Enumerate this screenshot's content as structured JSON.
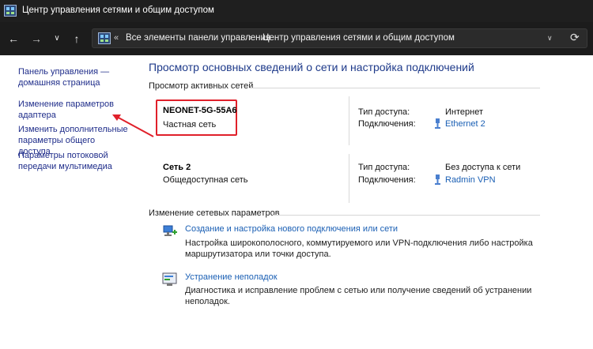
{
  "window": {
    "title": "Центр управления сетями и общим доступом"
  },
  "address_bar": {
    "crumbs": [
      "Все элементы панели управления",
      "Центр управления сетями и общим доступом"
    ]
  },
  "left_pane": {
    "links": [
      "Панель управления — домашняя страница",
      "Изменение параметров адаптера",
      "Изменить дополнительные параметры общего доступа",
      "Параметры потоковой передачи мультимедиа"
    ]
  },
  "main": {
    "title": "Просмотр основных сведений о сети и настройка подключений",
    "active_networks_label": "Просмотр активных сетей",
    "networks": [
      {
        "name": "NEONET-5G-55A6",
        "type": "Частная сеть",
        "access_label": "Тип доступа:",
        "access_value": "Интернет",
        "connections_label": "Подключения:",
        "connection": "Ethernet 2"
      },
      {
        "name": "Сеть 2",
        "type": "Общедоступная сеть",
        "access_label": "Тип доступа:",
        "access_value": "Без доступа к сети",
        "connections_label": "Подключения:",
        "connection": "Radmin VPN"
      }
    ],
    "change_settings_label": "Изменение сетевых параметров",
    "tasks": [
      {
        "icon": "new-connection-icon",
        "link": "Создание и настройка нового подключения или сети",
        "desc": "Настройка широкополосного, коммутируемого или VPN-подключения либо настройка маршрутизатора или точки доступа."
      },
      {
        "icon": "troubleshoot-icon",
        "link": "Устранение неполадок",
        "desc": "Диагностика и исправление проблем с сетью или получение сведений об устранении неполадок."
      }
    ]
  },
  "colors": {
    "highlight": "#e0202a",
    "link": "#1a5fb4",
    "title": "#1e3a8a"
  }
}
